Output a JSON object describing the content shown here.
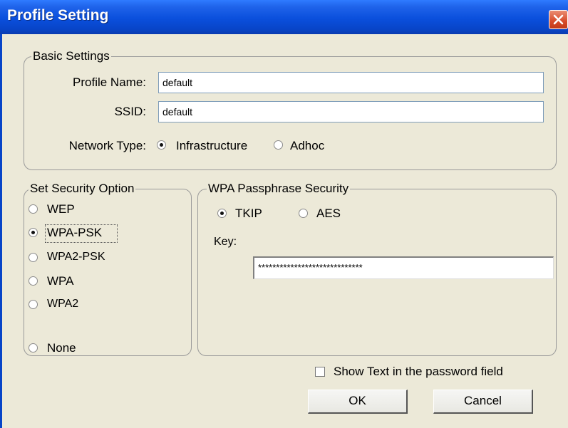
{
  "window": {
    "title": "Profile Setting",
    "close_icon": "close-icon"
  },
  "basic": {
    "legend": "Basic Settings",
    "profile_name_label": "Profile Name:",
    "profile_name_value": "default",
    "ssid_label": "SSID:",
    "ssid_value": "default",
    "network_type_label": "Network Type:",
    "infrastructure_label": "Infrastructure",
    "adhoc_label": "Adhoc",
    "network_type_selected": "Infrastructure"
  },
  "security": {
    "legend": "Set Security Option",
    "options": [
      "WEP",
      "WPA-PSK",
      "WPA2-PSK",
      "WPA",
      "WPA2",
      "None"
    ],
    "selected": "WPA-PSK"
  },
  "wpa": {
    "legend": "WPA Passphrase Security",
    "tkip_label": "TKIP",
    "aes_label": "AES",
    "selected": "TKIP",
    "key_label": "Key:",
    "key_value": "*****************************"
  },
  "footer": {
    "show_text_label": "Show Text in the password field",
    "show_text_checked": false,
    "ok_label": "OK",
    "cancel_label": "Cancel"
  },
  "colors": {
    "titlebar": "#0a4fdc",
    "dialog_bg": "#ece9d8",
    "close_button": "#d74b2a"
  }
}
